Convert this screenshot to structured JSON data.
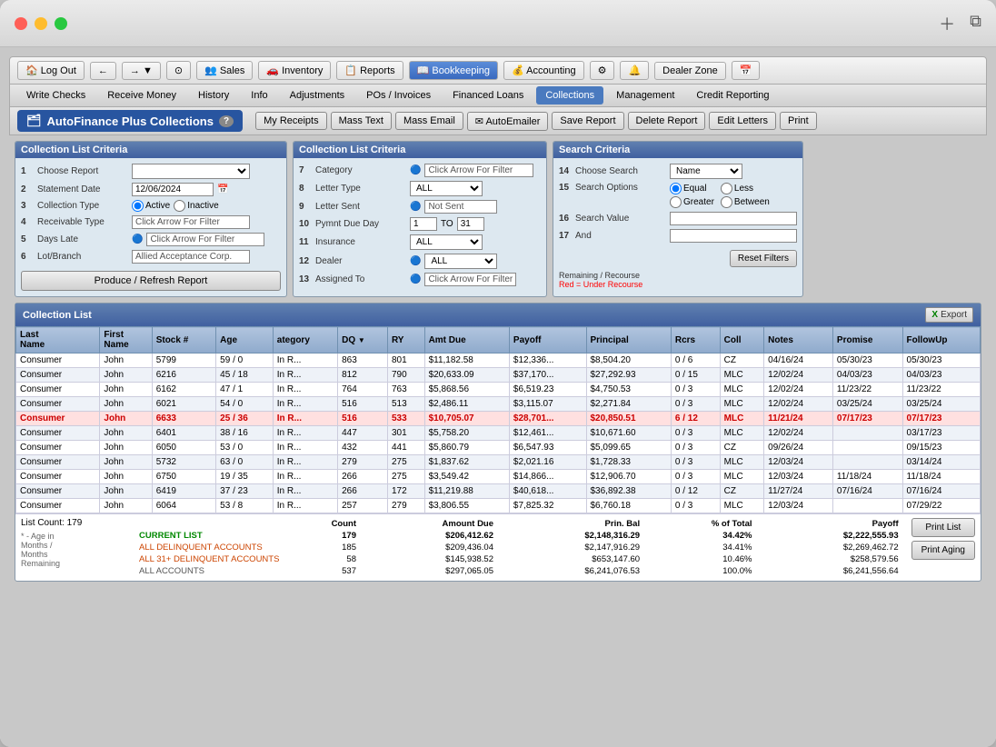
{
  "window": {
    "title": "AutoFinance Plus Collections"
  },
  "topNav": {
    "items": [
      {
        "label": "Log Out",
        "icon": "🏠",
        "active": false
      },
      {
        "label": "←",
        "active": false
      },
      {
        "label": "→",
        "active": false
      },
      {
        "label": "▼",
        "active": false
      },
      {
        "label": "⊙",
        "active": false
      },
      {
        "label": "Sales",
        "icon": "👥",
        "active": false
      },
      {
        "label": "Inventory",
        "icon": "🚗",
        "active": false
      },
      {
        "label": "Reports",
        "icon": "📋",
        "active": false
      },
      {
        "label": "Bookkeeping",
        "icon": "📖",
        "active": true
      },
      {
        "label": "Accounting",
        "icon": "💰",
        "active": false
      },
      {
        "label": "⚙",
        "active": false
      },
      {
        "label": "🔔",
        "active": false
      },
      {
        "label": "Dealer Zone",
        "active": false
      },
      {
        "label": "📅",
        "active": false
      }
    ]
  },
  "secondNav": {
    "items": [
      {
        "label": "Write Checks",
        "active": false
      },
      {
        "label": "Receive Money",
        "active": false
      },
      {
        "label": "History",
        "active": false
      },
      {
        "label": "Info",
        "active": false
      },
      {
        "label": "Adjustments",
        "active": false
      },
      {
        "label": "POs / Invoices",
        "active": false
      },
      {
        "label": "Financed Loans",
        "active": false
      },
      {
        "label": "Collections",
        "active": true
      },
      {
        "label": "Management",
        "active": false
      },
      {
        "label": "Credit Reporting",
        "active": false
      }
    ]
  },
  "actionRow": {
    "title": "Collections",
    "help": "?",
    "buttons": [
      {
        "label": "My Receipts"
      },
      {
        "label": "Mass Text"
      },
      {
        "label": "Mass Email"
      },
      {
        "label": "✉ AutoEmailer"
      },
      {
        "label": "Save Report"
      },
      {
        "label": "Delete Report"
      },
      {
        "label": "Edit Letters"
      },
      {
        "label": "Print"
      }
    ]
  },
  "leftCriteria": {
    "title": "Collection List Criteria",
    "rows": [
      {
        "num": "1",
        "label": "Choose Report",
        "value": "",
        "type": "select"
      },
      {
        "num": "2",
        "label": "Statement Date",
        "value": "12/06/2024",
        "type": "date"
      },
      {
        "num": "3",
        "label": "Collection Type",
        "value": "Active / Inactive",
        "type": "radio"
      },
      {
        "num": "4",
        "label": "Receivable Type",
        "value": "Click Arrow For Filter",
        "type": "filter"
      },
      {
        "num": "5",
        "label": "Days Late",
        "value": "Click Arrow For Filter",
        "type": "filter"
      },
      {
        "num": "6",
        "label": "Lot/Branch",
        "value": "Allied Acceptance Corp.",
        "type": "text"
      }
    ],
    "produceBtn": "Produce / Refresh Report"
  },
  "middleCriteria": {
    "title": "Collection List Criteria",
    "rows": [
      {
        "num": "7",
        "label": "Category",
        "value": "Click Arrow For Filter",
        "type": "filter"
      },
      {
        "num": "8",
        "label": "Letter Type",
        "value": "ALL",
        "type": "select"
      },
      {
        "num": "9",
        "label": "Letter Sent",
        "value": "Not Sent",
        "type": "filter"
      },
      {
        "num": "10",
        "label": "Pymnt Due Day",
        "value": "1",
        "to": "31",
        "type": "range"
      },
      {
        "num": "11",
        "label": "Insurance",
        "value": "ALL",
        "type": "select"
      },
      {
        "num": "12",
        "label": "Dealer",
        "value": "ALL",
        "type": "filter"
      },
      {
        "num": "13",
        "label": "Assigned To",
        "value": "Click Arrow For Filter",
        "type": "filter"
      }
    ]
  },
  "searchCriteria": {
    "title": "Search Criteria",
    "rows": [
      {
        "num": "14",
        "label": "Choose Search",
        "value": "Name",
        "type": "select"
      },
      {
        "num": "15",
        "label": "Search Options",
        "options": [
          "Equal",
          "Less",
          "Greater",
          "Between"
        ]
      },
      {
        "num": "16",
        "label": "Search Value",
        "value": ""
      },
      {
        "num": "17",
        "label": "And",
        "value": ""
      }
    ],
    "resetBtn": "Reset Filters",
    "recourseNote": "Remaining / Recourse",
    "recourseRed": "Red = Under Recourse"
  },
  "collectionList": {
    "title": "Collection List",
    "exportBtn": "Export",
    "columns": [
      "Last Name",
      "First Name",
      "Stock #",
      "Age",
      "ategory",
      "DQ",
      "RY",
      "Amt Due",
      "Payoff",
      "Principal",
      "Rcrs",
      "Coll",
      "Notes",
      "Promise",
      "FollowUp"
    ],
    "rows": [
      {
        "last": "Consumer",
        "first": "John",
        "stock": "5799",
        "age": "59 / 0",
        "cat": "In R...",
        "dq": "863",
        "ry": "801",
        "amtDue": "$11,182.58",
        "payoff": "$12,336...",
        "principal": "$8,504.20",
        "rcrs": "0 / 6",
        "coll": "CZ",
        "notes": "04/16/24",
        "promise": "05/30/23",
        "followup": "05/30/23",
        "highlight": false
      },
      {
        "last": "Consumer",
        "first": "John",
        "stock": "6216",
        "age": "45 / 18",
        "cat": "In R...",
        "dq": "812",
        "ry": "790",
        "amtDue": "$20,633.09",
        "payoff": "$37,170...",
        "principal": "$27,292.93",
        "rcrs": "0 / 15",
        "coll": "MLC",
        "notes": "12/02/24",
        "promise": "04/03/23",
        "followup": "04/03/23",
        "highlight": false
      },
      {
        "last": "Consumer",
        "first": "John",
        "stock": "6162",
        "age": "47 / 1",
        "cat": "In R...",
        "dq": "764",
        "ry": "763",
        "amtDue": "$5,868.56",
        "payoff": "$6,519.23",
        "principal": "$4,750.53",
        "rcrs": "0 / 3",
        "coll": "MLC",
        "notes": "12/02/24",
        "promise": "11/23/22",
        "followup": "11/23/22",
        "highlight": false
      },
      {
        "last": "Consumer",
        "first": "John",
        "stock": "6021",
        "age": "54 / 0",
        "cat": "In R...",
        "dq": "516",
        "ry": "513",
        "amtDue": "$2,486.11",
        "payoff": "$3,115.07",
        "principal": "$2,271.84",
        "rcrs": "0 / 3",
        "coll": "MLC",
        "notes": "12/02/24",
        "promise": "03/25/24",
        "followup": "03/25/24",
        "highlight": false
      },
      {
        "last": "Consumer",
        "first": "John",
        "stock": "6633",
        "age": "25 / 36",
        "cat": "In R...",
        "dq": "516",
        "ry": "533",
        "amtDue": "$10,705.07",
        "payoff": "$28,701...",
        "principal": "$20,850.51",
        "rcrs": "6 / 12",
        "coll": "MLC",
        "notes": "11/21/24",
        "promise": "07/17/23",
        "followup": "07/17/23",
        "highlight": true
      },
      {
        "last": "Consumer",
        "first": "John",
        "stock": "6401",
        "age": "38 / 16",
        "cat": "In R...",
        "dq": "447",
        "ry": "301",
        "amtDue": "$5,758.20",
        "payoff": "$12,461...",
        "principal": "$10,671.60",
        "rcrs": "0 / 3",
        "coll": "MLC",
        "notes": "12/02/24",
        "promise": "",
        "followup": "03/17/23",
        "highlight": false
      },
      {
        "last": "Consumer",
        "first": "John",
        "stock": "6050",
        "age": "53 / 0",
        "cat": "In R...",
        "dq": "432",
        "ry": "441",
        "amtDue": "$5,860.79",
        "payoff": "$6,547.93",
        "principal": "$5,099.65",
        "rcrs": "0 / 3",
        "coll": "CZ",
        "notes": "09/26/24",
        "promise": "",
        "followup": "09/15/23",
        "highlight": false
      },
      {
        "last": "Consumer",
        "first": "John",
        "stock": "5732",
        "age": "63 / 0",
        "cat": "In R...",
        "dq": "279",
        "ry": "275",
        "amtDue": "$1,837.62",
        "payoff": "$2,021.16",
        "principal": "$1,728.33",
        "rcrs": "0 / 3",
        "coll": "MLC",
        "notes": "12/03/24",
        "promise": "",
        "followup": "03/14/24",
        "highlight": false
      },
      {
        "last": "Consumer",
        "first": "John",
        "stock": "6750",
        "age": "19 / 35",
        "cat": "In R...",
        "dq": "266",
        "ry": "275",
        "amtDue": "$3,549.42",
        "payoff": "$14,866...",
        "principal": "$12,906.70",
        "rcrs": "0 / 3",
        "coll": "MLC",
        "notes": "12/03/24",
        "promise": "11/18/24",
        "followup": "11/18/24",
        "highlight": false
      },
      {
        "last": "Consumer",
        "first": "John",
        "stock": "6419",
        "age": "37 / 23",
        "cat": "In R...",
        "dq": "266",
        "ry": "172",
        "amtDue": "$11,219.88",
        "payoff": "$40,618...",
        "principal": "$36,892.38",
        "rcrs": "0 / 12",
        "coll": "CZ",
        "notes": "11/27/24",
        "promise": "07/16/24",
        "followup": "07/16/24",
        "highlight": false
      },
      {
        "last": "Consumer",
        "first": "John",
        "stock": "6064",
        "age": "53 / 8",
        "cat": "In R...",
        "dq": "257",
        "ry": "279",
        "amtDue": "$3,806.55",
        "payoff": "$7,825.32",
        "principal": "$6,760.18",
        "rcrs": "0 / 3",
        "coll": "MLC",
        "notes": "12/03/24",
        "promise": "",
        "followup": "07/29/22",
        "highlight": false
      }
    ],
    "listCount": "List Count: 179",
    "ageNote": "* - Age in Months / Months Remaining",
    "totals": {
      "headers": [
        "Count",
        "Amount Due",
        "Prin. Bal",
        "% of Total",
        "Payoff"
      ],
      "rows": [
        {
          "label": "CURRENT LIST",
          "count": "179",
          "amtDue": "$206,412.62",
          "prinBal": "$2,148,316.29",
          "pct": "34.42%",
          "payoff": "$2,222,555.93",
          "color": "current"
        },
        {
          "label": "ALL DELINQUENT ACCOUNTS",
          "count": "185",
          "amtDue": "$209,436.04",
          "prinBal": "$2,147,916.29",
          "pct": "34.41%",
          "payoff": "$2,269,462.72",
          "color": "normal"
        },
        {
          "label": "ALL 31+ DELINQUENT ACCOUNTS",
          "count": "58",
          "amtDue": "$145,938.52",
          "prinBal": "$653,147.60",
          "pct": "10.46%",
          "payoff": "$258,579.56",
          "color": "normal"
        },
        {
          "label": "ALL ACCOUNTS",
          "count": "537",
          "amtDue": "$297,065.05",
          "prinBal": "$6,241,076.53",
          "pct": "100.0%",
          "payoff": "$6,241,556.64",
          "color": "normal"
        }
      ]
    },
    "printBtns": [
      "Print List",
      "Print Aging"
    ]
  }
}
